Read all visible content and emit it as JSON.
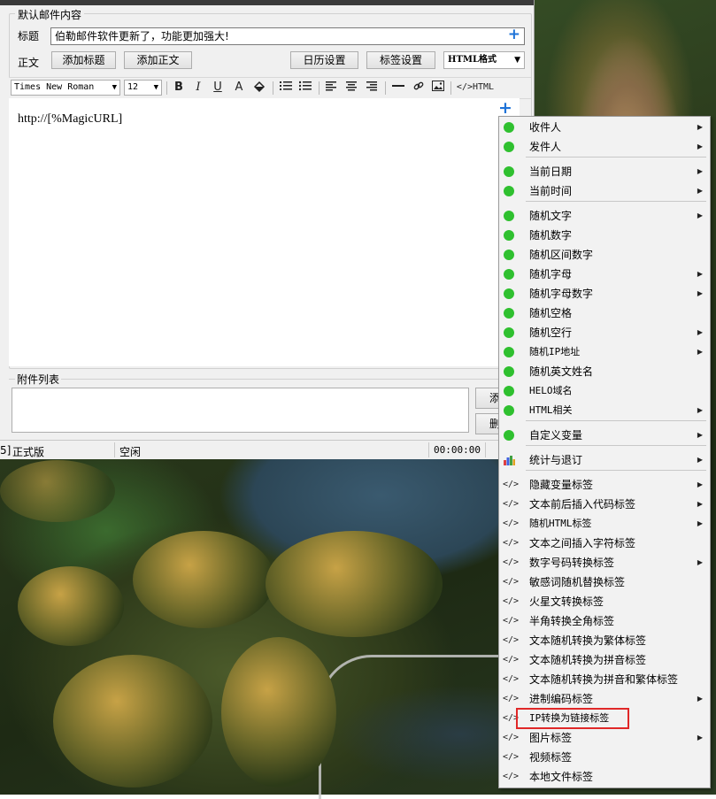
{
  "content_group": {
    "title": "默认邮件内容",
    "subject_label": "标题",
    "subject_value": "伯勒邮件软件更新了，功能更加强大!",
    "add_icon": "+",
    "body_label": "正文",
    "buttons": {
      "add_title": "添加标题",
      "add_body": "添加正文",
      "calendar": "日历设置",
      "tags": "标签设置"
    },
    "format_select": "HTML格式"
  },
  "toolbar": {
    "font": "Times New Roman",
    "size": "12",
    "bold": "B",
    "italic": "I",
    "underline": "U",
    "font_color": "A",
    "html_toggle": "</>HTML"
  },
  "editor": {
    "content": "http://[%MagicURL]"
  },
  "attachments": {
    "title": "附件列表",
    "add_button": "添",
    "delete_button": "删"
  },
  "statusbar": {
    "left_fragment": "5]",
    "edition": "正式版",
    "state": "空闲",
    "timer": "00:00:00"
  },
  "menu": {
    "items": [
      {
        "label": "收件人",
        "icon": "green-dot",
        "submenu": true
      },
      {
        "label": "发件人",
        "icon": "green-dot",
        "submenu": true
      },
      {
        "label": "当前日期",
        "icon": "green-dot",
        "submenu": true
      },
      {
        "label": "当前时间",
        "icon": "green-dot",
        "submenu": true
      },
      {
        "label": "随机文字",
        "icon": "green-dot",
        "submenu": true
      },
      {
        "label": "随机数字",
        "icon": "green-dot",
        "submenu": false
      },
      {
        "label": "随机区间数字",
        "icon": "green-dot",
        "submenu": false
      },
      {
        "label": "随机字母",
        "icon": "green-dot",
        "submenu": true
      },
      {
        "label": "随机字母数字",
        "icon": "green-dot",
        "submenu": true
      },
      {
        "label": "随机空格",
        "icon": "green-dot",
        "submenu": false
      },
      {
        "label": "随机空行",
        "icon": "green-dot",
        "submenu": true
      },
      {
        "label": "随机IP地址",
        "icon": "green-dot",
        "submenu": true
      },
      {
        "label": "随机英文姓名",
        "icon": "green-dot",
        "submenu": false
      },
      {
        "label": "HELO域名",
        "icon": "green-dot",
        "submenu": false
      },
      {
        "label": "HTML相关",
        "icon": "green-dot",
        "submenu": true
      },
      {
        "label": "自定义变量",
        "icon": "green-dot",
        "submenu": true
      },
      {
        "label": "统计与退订",
        "icon": "chart-icon",
        "submenu": true
      },
      {
        "label": "隐藏变量标签",
        "icon": "code-icon",
        "submenu": true
      },
      {
        "label": "文本前后插入代码标签",
        "icon": "code-icon",
        "submenu": true
      },
      {
        "label": "随机HTML标签",
        "icon": "code-icon",
        "submenu": true
      },
      {
        "label": "文本之间插入字符标签",
        "icon": "code-icon",
        "submenu": false
      },
      {
        "label": "数字号码转换标签",
        "icon": "code-icon",
        "submenu": true
      },
      {
        "label": "敏感词随机替换标签",
        "icon": "code-icon",
        "submenu": false
      },
      {
        "label": "火星文转换标签",
        "icon": "code-icon",
        "submenu": false
      },
      {
        "label": "半角转换全角标签",
        "icon": "code-icon",
        "submenu": false
      },
      {
        "label": "文本随机转换为繁体标签",
        "icon": "code-icon",
        "submenu": false
      },
      {
        "label": "文本随机转换为拼音标签",
        "icon": "code-icon",
        "submenu": false
      },
      {
        "label": "文本随机转换为拼音和繁体标签",
        "icon": "code-icon",
        "submenu": false
      },
      {
        "label": "进制编码标签",
        "icon": "code-icon",
        "submenu": true
      },
      {
        "label": "IP转换为链接标签",
        "icon": "code-icon",
        "submenu": false,
        "highlighted": true
      },
      {
        "label": "图片标签",
        "icon": "code-icon",
        "submenu": true
      },
      {
        "label": "视频标签",
        "icon": "code-icon",
        "submenu": false
      },
      {
        "label": "本地文件标签",
        "icon": "code-icon",
        "submenu": false
      }
    ],
    "highlight_color": "#e02828",
    "dot_color": "#2fc02f"
  },
  "colors": {
    "accent_blue": "#1e73d8",
    "window_bg": "#f0f0f0"
  }
}
